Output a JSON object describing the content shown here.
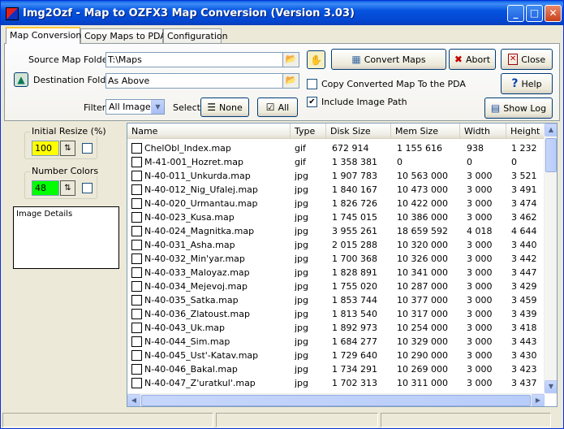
{
  "window": {
    "title": "Img2Ozf - Map to OZFX3 Map Conversion (Version 3.03)",
    "controls": {
      "minimize": "_",
      "maximize": "□",
      "close": "✕"
    }
  },
  "tabs": [
    {
      "label": "Map Conversion",
      "active": true
    },
    {
      "label": "Copy Maps to PDA",
      "active": false
    },
    {
      "label": "Configuration",
      "active": false
    }
  ],
  "form": {
    "source_label": "Source Map Folder",
    "source_value": "T:\\Maps",
    "dest_label": "Destination Folder",
    "dest_value": "As Above",
    "filter_label": "Filter",
    "filter_value": "All Images",
    "select_label": "Select",
    "none_label": "None",
    "all_label": "All",
    "copy_to_pda_label": "Copy Converted Map To the PDA",
    "copy_to_pda_checked": false,
    "include_path_label": "Include Image Path",
    "include_path_checked": true
  },
  "buttons": {
    "convert": "Convert Maps",
    "abort": "Abort",
    "close": "Close",
    "help": "Help",
    "show_log": "Show Log"
  },
  "left_panel": {
    "initial_resize_label": "Initial Resize (%)",
    "initial_resize_value": "100",
    "number_colors_label": "Number Colors",
    "number_colors_value": "48",
    "details_label": "Image Details"
  },
  "table": {
    "columns": [
      "Name",
      "Type",
      "Disk Size",
      "Mem Size",
      "Width",
      "Height"
    ],
    "rows": [
      {
        "name": "ChelObl_Index.map",
        "type": "gif",
        "disk": "672 914",
        "mem": "1 155 616",
        "width": "938",
        "height": "1 232"
      },
      {
        "name": "M-41-001_Hozret.map",
        "type": "gif",
        "disk": "1 358 381",
        "mem": "0",
        "width": "0",
        "height": "0"
      },
      {
        "name": "N-40-011_Unkurda.map",
        "type": "jpg",
        "disk": "1 907 783",
        "mem": "10 563 000",
        "width": "3 000",
        "height": "3 521"
      },
      {
        "name": "N-40-012_Nig_Ufalej.map",
        "type": "jpg",
        "disk": "1 840 167",
        "mem": "10 473 000",
        "width": "3 000",
        "height": "3 491"
      },
      {
        "name": "N-40-020_Urmantau.map",
        "type": "jpg",
        "disk": "1 826 726",
        "mem": "10 422 000",
        "width": "3 000",
        "height": "3 474"
      },
      {
        "name": "N-40-023_Kusa.map",
        "type": "jpg",
        "disk": "1 745 015",
        "mem": "10 386 000",
        "width": "3 000",
        "height": "3 462"
      },
      {
        "name": "N-40-024_Magnitka.map",
        "type": "jpg",
        "disk": "3 955 261",
        "mem": "18 659 592",
        "width": "4 018",
        "height": "4 644"
      },
      {
        "name": "N-40-031_Asha.map",
        "type": "jpg",
        "disk": "2 015 288",
        "mem": "10 320 000",
        "width": "3 000",
        "height": "3 440"
      },
      {
        "name": "N-40-032_Min'yar.map",
        "type": "jpg",
        "disk": "1 700 368",
        "mem": "10 326 000",
        "width": "3 000",
        "height": "3 442"
      },
      {
        "name": "N-40-033_Maloyaz.map",
        "type": "jpg",
        "disk": "1 828 891",
        "mem": "10 341 000",
        "width": "3 000",
        "height": "3 447"
      },
      {
        "name": "N-40-034_Mejevoj.map",
        "type": "jpg",
        "disk": "1 755 020",
        "mem": "10 287 000",
        "width": "3 000",
        "height": "3 429"
      },
      {
        "name": "N-40-035_Satka.map",
        "type": "jpg",
        "disk": "1 853 744",
        "mem": "10 377 000",
        "width": "3 000",
        "height": "3 459"
      },
      {
        "name": "N-40-036_Zlatoust.map",
        "type": "jpg",
        "disk": "1 813 540",
        "mem": "10 317 000",
        "width": "3 000",
        "height": "3 439"
      },
      {
        "name": "N-40-043_Uk.map",
        "type": "jpg",
        "disk": "1 892 973",
        "mem": "10 254 000",
        "width": "3 000",
        "height": "3 418"
      },
      {
        "name": "N-40-044_Sim.map",
        "type": "jpg",
        "disk": "1 684 277",
        "mem": "10 329 000",
        "width": "3 000",
        "height": "3 443"
      },
      {
        "name": "N-40-045_Ust'-Katav.map",
        "type": "jpg",
        "disk": "1 729 640",
        "mem": "10 290 000",
        "width": "3 000",
        "height": "3 430"
      },
      {
        "name": "N-40-046_Bakal.map",
        "type": "jpg",
        "disk": "1 734 291",
        "mem": "10 269 000",
        "width": "3 000",
        "height": "3 423"
      },
      {
        "name": "N-40-047_Z'uratkul'.map",
        "type": "jpg",
        "disk": "1 702 313",
        "mem": "10 311 000",
        "width": "3 000",
        "height": "3 437"
      }
    ]
  },
  "colors": {
    "resize_bg": "#ffff00",
    "colors_bg": "#00ff00",
    "titlebar": "#0554e0"
  }
}
